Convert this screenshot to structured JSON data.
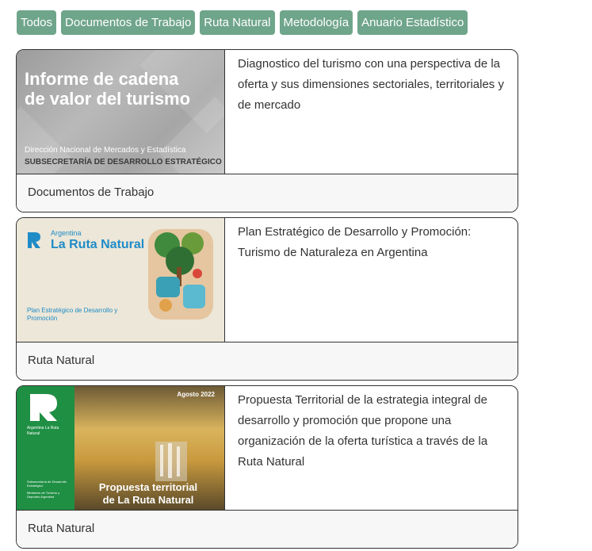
{
  "filters": [
    "Todos",
    "Documentos de Trabajo",
    "Ruta Natural",
    "Metodología",
    "Anuario Estadístico"
  ],
  "cards": [
    {
      "thumb": {
        "title": "Informe de cadena de valor del turismo",
        "line1": "Dirección Nacional de Mercados y Estadística",
        "line2": "SUBSECRETARÍA DE DESARROLLO ESTRATÉGICO"
      },
      "description": "Diagnostico del turismo con una perspectiva de la oferta y sus dimensiones sectoriales, territoriales y de mercado",
      "category": "Documentos de Trabajo"
    },
    {
      "thumb": {
        "country": "Argentina",
        "brand": "La Ruta Natural",
        "plan": "Plan Estratégico de Desarrollo y Promoción"
      },
      "description": "Plan Estratégico de Desarrollo y Promoción: Turismo de Naturaleza en Argentina",
      "category": "Ruta Natural"
    },
    {
      "thumb": {
        "date": "Agosto 2022",
        "brand": "Argentina La Ruta Natural",
        "sub": "Subsecretaría de Desarrollo Estratégico",
        "ministry": "Ministerio de Turismo y Deportes Argentina",
        "title": "Propuesta territorial de La Ruta Natural"
      },
      "description": "Propuesta Territorial de la estrategia integral de desarrollo y promoción que propone una organización de la oferta turística a través de la Ruta Natural",
      "category": "Ruta Natural"
    }
  ]
}
